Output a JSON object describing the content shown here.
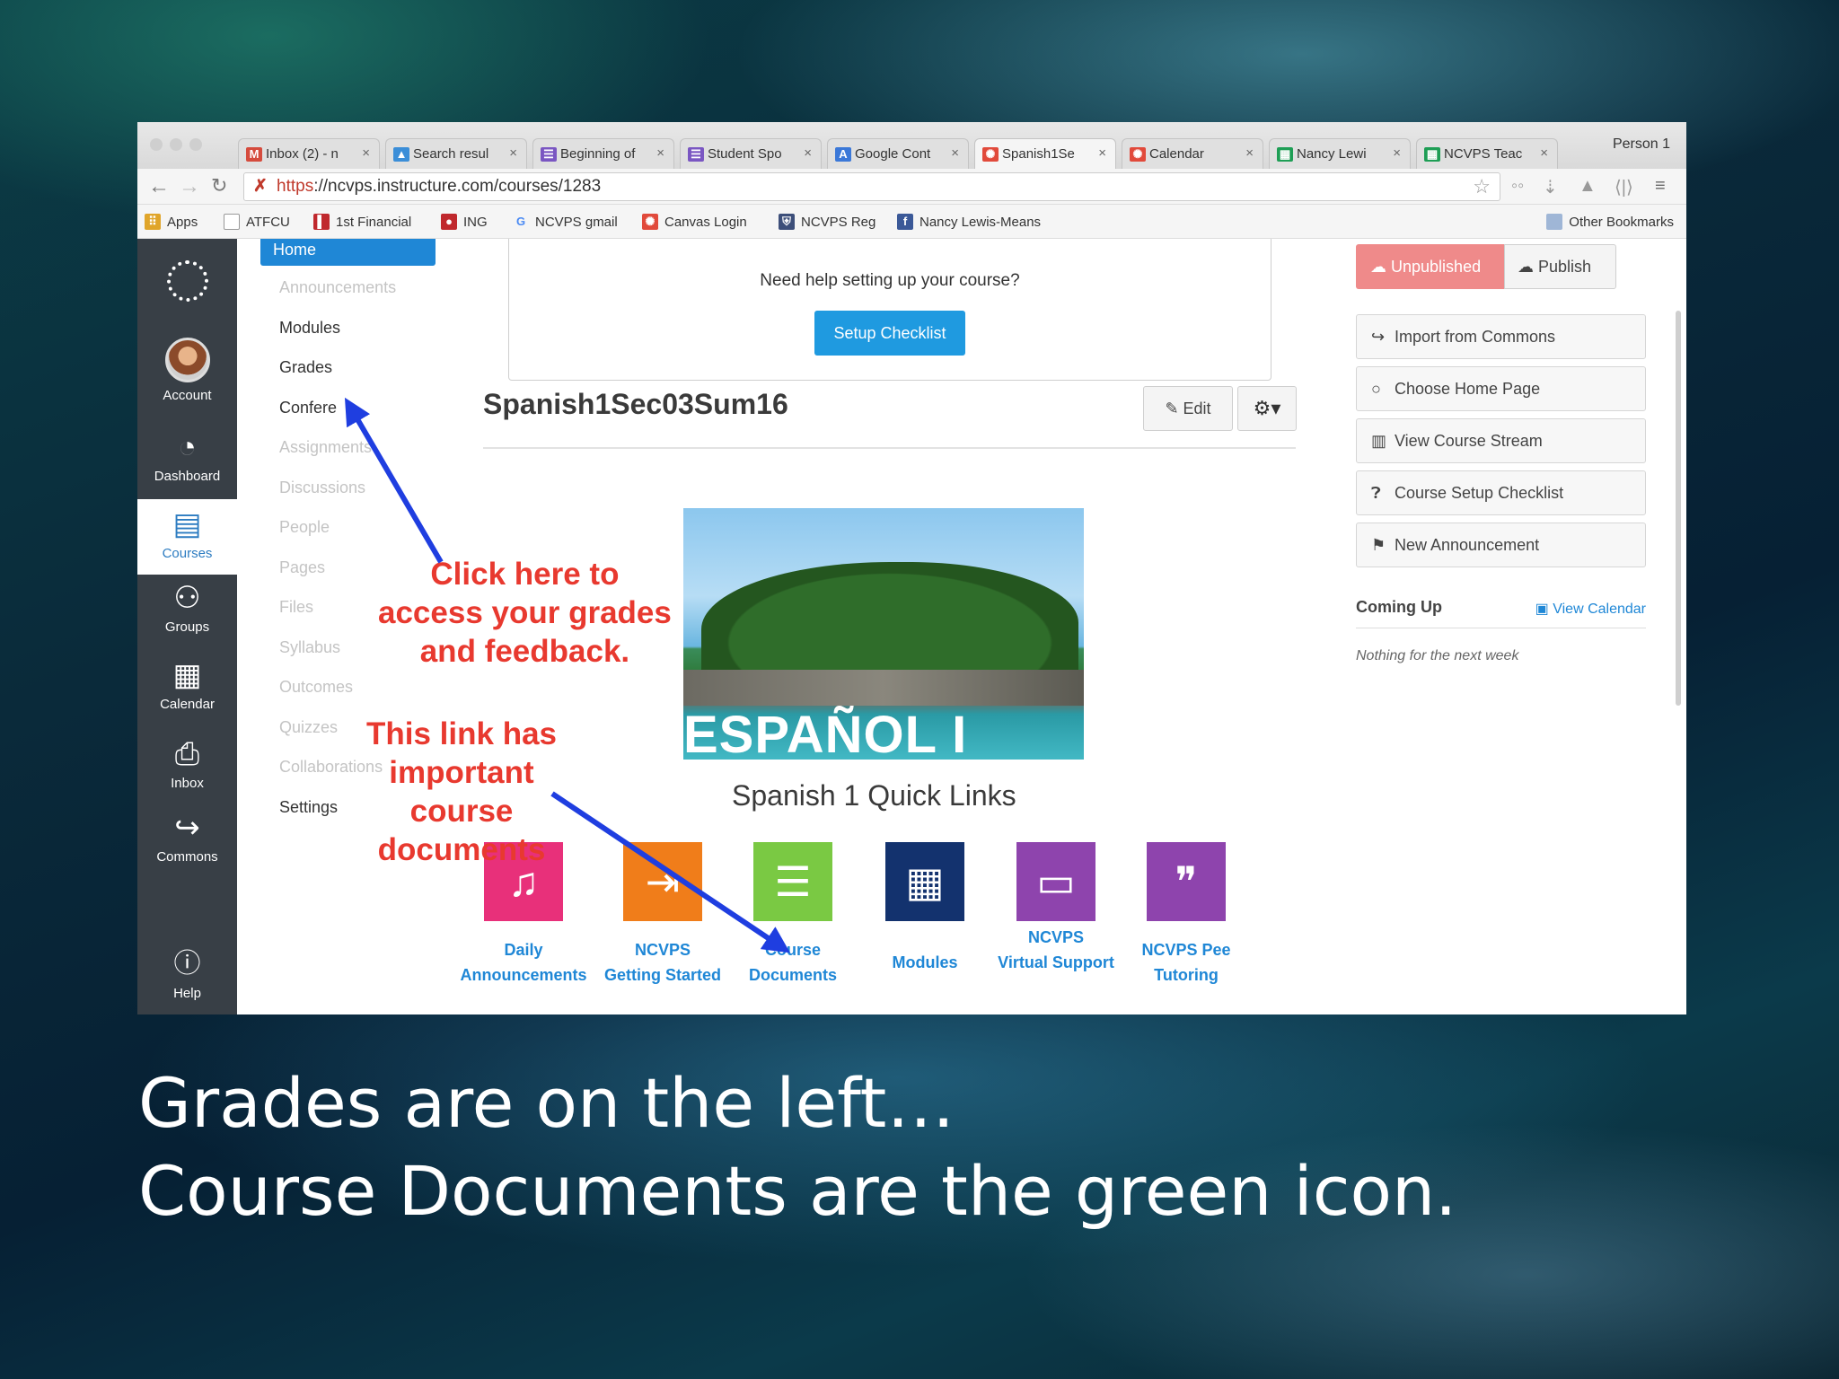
{
  "browser": {
    "tabs": [
      {
        "label": "Inbox (2) - n",
        "icon": "gmail-icon",
        "color": "#d54b3d"
      },
      {
        "label": "Search resul",
        "icon": "drive-icon",
        "color": "#3b8ed8"
      },
      {
        "label": "Beginning of",
        "icon": "forms-icon",
        "color": "#7a56c2"
      },
      {
        "label": "Student Spo",
        "icon": "forms-icon",
        "color": "#7a56c2"
      },
      {
        "label": "Google Cont",
        "icon": "contacts-icon",
        "color": "#3b78d8"
      },
      {
        "label": "Spanish1Se",
        "icon": "canvas-icon",
        "color": "#e14a3b"
      },
      {
        "label": "Calendar",
        "icon": "canvas-icon",
        "color": "#e14a3b"
      },
      {
        "label": "Nancy Lewi",
        "icon": "sheets-icon",
        "color": "#1e9e55"
      },
      {
        "label": "NCVPS Teac",
        "icon": "sheets-icon",
        "color": "#1e9e55"
      }
    ],
    "profile": "Person 1",
    "url_scheme": "https",
    "url_rest": "://ncvps.instructure.com/courses/1283",
    "bookmarks": [
      {
        "label": "Apps",
        "icon": "apps-icon",
        "color": "#e0a52a"
      },
      {
        "label": "ATFCU",
        "icon": "page-icon",
        "color": "#ffffff"
      },
      {
        "label": "1st Financial",
        "icon": "bank-icon",
        "color": "#c0282d"
      },
      {
        "label": "ING",
        "icon": "ing-icon",
        "color": "#c0282d"
      },
      {
        "label": "NCVPS gmail",
        "icon": "google-icon",
        "color": "#4a8af4"
      },
      {
        "label": "Canvas Login",
        "icon": "canvas-icon",
        "color": "#e14a3b"
      },
      {
        "label": "NCVPS Reg",
        "icon": "shield-icon",
        "color": "#3d4f7a"
      },
      {
        "label": "Nancy Lewis-Means",
        "icon": "facebook-icon",
        "color": "#3b5998"
      }
    ],
    "other_bookmarks": "Other Bookmarks"
  },
  "global_nav": {
    "items": [
      {
        "label": "Account"
      },
      {
        "label": "Dashboard"
      },
      {
        "label": "Courses"
      },
      {
        "label": "Groups"
      },
      {
        "label": "Calendar"
      },
      {
        "label": "Inbox"
      },
      {
        "label": "Commons"
      },
      {
        "label": "Help"
      }
    ]
  },
  "course_nav": {
    "home": "Home",
    "items": [
      {
        "label": "Announcements",
        "dim": true
      },
      {
        "label": "Modules",
        "dim": false
      },
      {
        "label": "Grades",
        "dim": false
      },
      {
        "label": "Confere",
        "dim": false
      },
      {
        "label": "Assignments",
        "dim": true
      },
      {
        "label": "Discussions",
        "dim": true
      },
      {
        "label": "People",
        "dim": true
      },
      {
        "label": "Pages",
        "dim": true
      },
      {
        "label": "Files",
        "dim": true
      },
      {
        "label": "Syllabus",
        "dim": true
      },
      {
        "label": "Outcomes",
        "dim": true
      },
      {
        "label": "Quizzes",
        "dim": true
      },
      {
        "label": "Collaborations",
        "dim": true
      },
      {
        "label": "Settings",
        "dim": false
      }
    ]
  },
  "main": {
    "help_text": "Need help setting up your course?",
    "setup_checklist": "Setup Checklist",
    "course_title": "Spanish1Sec03Sum16",
    "edit_label": "Edit",
    "banner_text": "ESPAÑOL I",
    "quick_links_title": "Spanish 1 Quick Links",
    "quick_links": [
      {
        "line1": "Daily",
        "line2": "Announcements",
        "icon": "bell-icon",
        "color": "#e8307a"
      },
      {
        "line1": "NCVPS",
        "line2": "Getting Started",
        "icon": "enter-icon",
        "color": "#f07d1a"
      },
      {
        "line1": "Course",
        "line2": "Documents",
        "icon": "clipboard-icon",
        "color": "#7ac943"
      },
      {
        "line1": "Modules",
        "line2": "",
        "icon": "grid-icon",
        "color": "#13326e"
      },
      {
        "line1": "NCVPS",
        "line2": "Virtual Support",
        "icon": "laptop-icon",
        "color": "#8e44ad"
      },
      {
        "line1": "NCVPS Pee",
        "line2": "Tutoring",
        "icon": "chat-icon",
        "color": "#8e44ad"
      }
    ]
  },
  "sidebar": {
    "unpublished": "Unpublished",
    "publish": "Publish",
    "buttons": [
      {
        "label": "Import from Commons",
        "icon": "commons-icon"
      },
      {
        "label": "Choose Home Page",
        "icon": "circle-icon"
      },
      {
        "label": "View Course Stream",
        "icon": "bar-chart-icon"
      },
      {
        "label": "Course Setup Checklist",
        "icon": "question-icon"
      },
      {
        "label": "New Announcement",
        "icon": "megaphone-icon"
      }
    ],
    "coming_up": "Coming Up",
    "view_calendar": "View Calendar",
    "nothing": "Nothing for the next week"
  },
  "annotations": {
    "grades_note": [
      "Click here to",
      "access your grades",
      "and feedback."
    ],
    "docs_note": [
      "This link has",
      "important",
      "course",
      "documents"
    ],
    "arrow_color": "#1f3ee0"
  },
  "caption": {
    "line1": "Grades are on the left…",
    "line2": "Course Documents are the green icon."
  }
}
